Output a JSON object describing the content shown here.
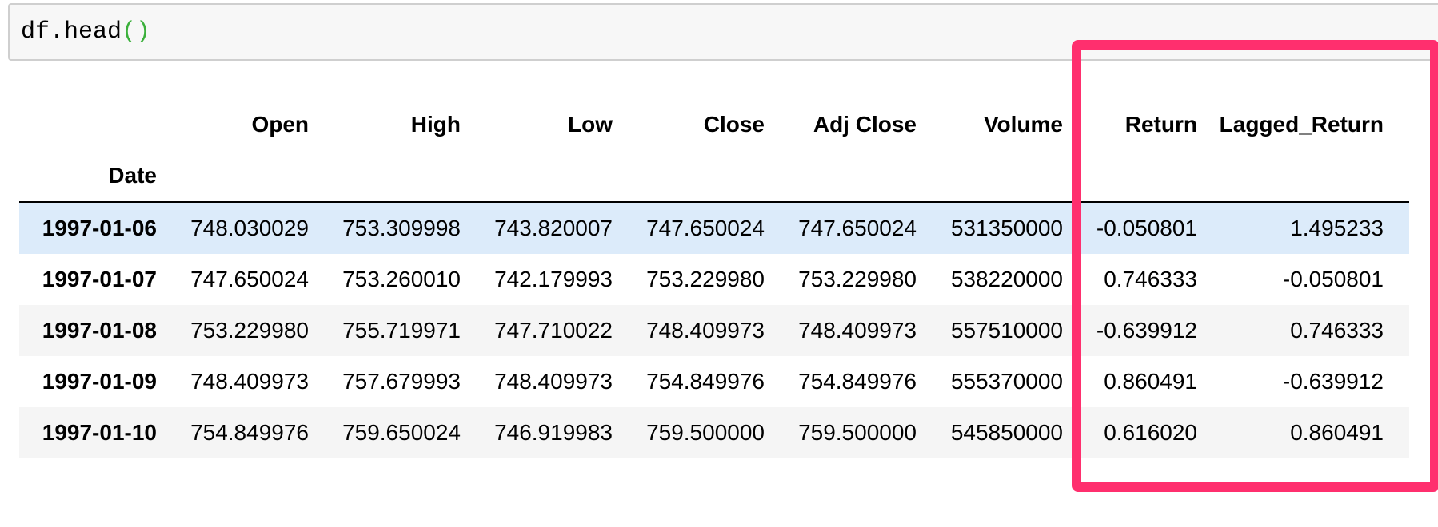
{
  "cell": {
    "code_fn": "df.head",
    "code_parens": "()"
  },
  "table": {
    "index_name": "Date",
    "columns": [
      "Open",
      "High",
      "Low",
      "Close",
      "Adj Close",
      "Volume",
      "Return",
      "Lagged_Return"
    ],
    "rows": [
      {
        "date": "1997-01-06",
        "values": [
          "748.030029",
          "753.309998",
          "743.820007",
          "747.650024",
          "747.650024",
          "531350000",
          "-0.050801",
          "1.495233"
        ]
      },
      {
        "date": "1997-01-07",
        "values": [
          "747.650024",
          "753.260010",
          "742.179993",
          "753.229980",
          "753.229980",
          "538220000",
          "0.746333",
          "-0.050801"
        ]
      },
      {
        "date": "1997-01-08",
        "values": [
          "753.229980",
          "755.719971",
          "747.710022",
          "748.409973",
          "748.409973",
          "557510000",
          "-0.639912",
          "0.746333"
        ]
      },
      {
        "date": "1997-01-09",
        "values": [
          "748.409973",
          "757.679993",
          "748.409973",
          "754.849976",
          "754.849976",
          "555370000",
          "0.860491",
          "-0.639912"
        ]
      },
      {
        "date": "1997-01-10",
        "values": [
          "754.849976",
          "759.650024",
          "746.919983",
          "759.500000",
          "759.500000",
          "545850000",
          "0.616020",
          "0.860491"
        ]
      }
    ]
  },
  "colors": {
    "highlight_box": "#ff2f6e",
    "hover_row": "#dcebfa",
    "striped_row": "#f5f5f5",
    "code_paren": "#3bb03b"
  }
}
